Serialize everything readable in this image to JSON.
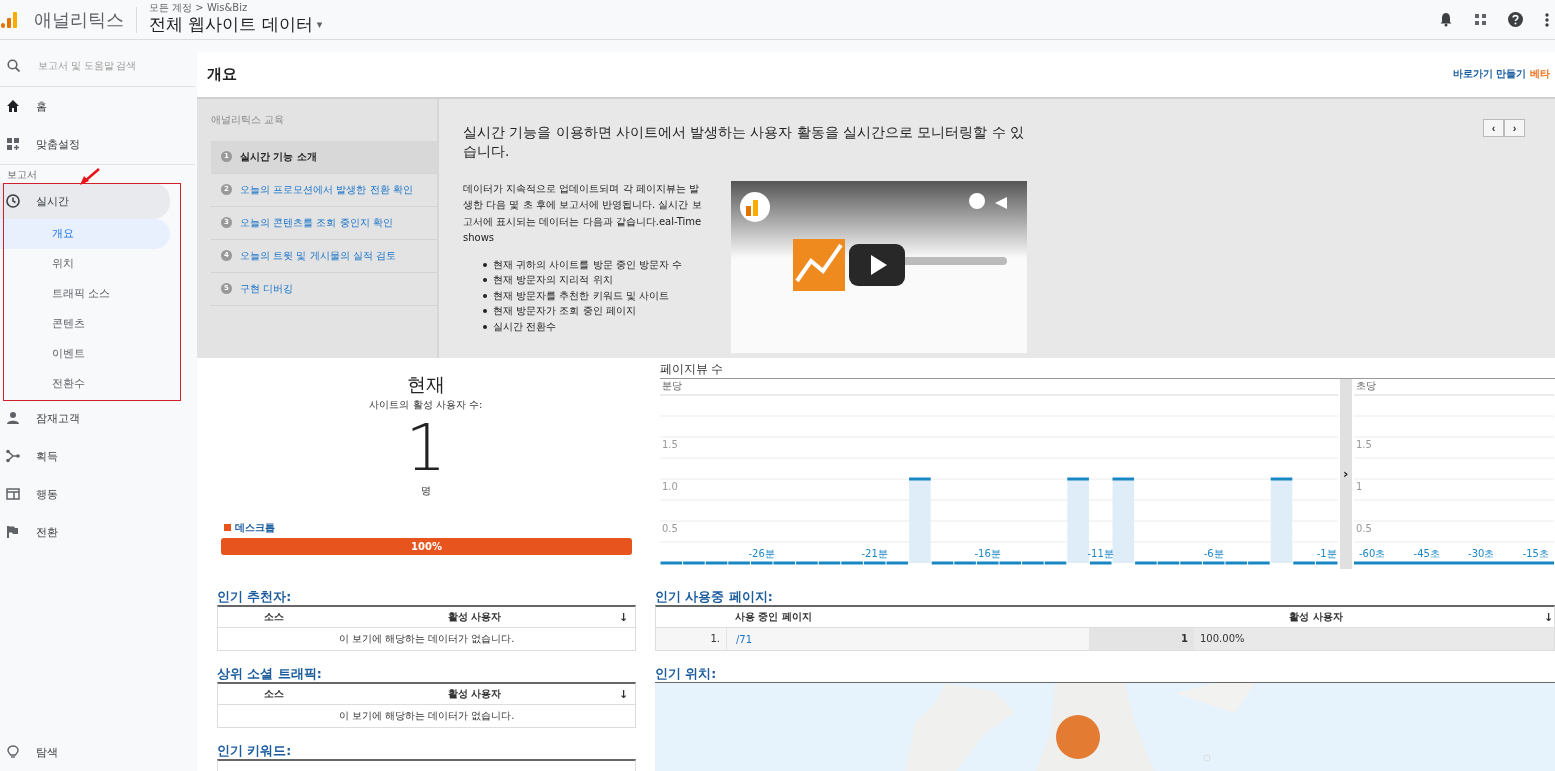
{
  "header": {
    "logo_text": "애널리틱스",
    "breadcrumb": "모든 계정 > Wis&Biz",
    "property": "전체 웹사이트 데이터",
    "caret": "▾"
  },
  "search": {
    "placeholder": "보고서 및 도움말 검색"
  },
  "sidebar": {
    "items": [
      {
        "label": "홈"
      },
      {
        "label": "맞춤설정"
      }
    ],
    "section_label": "보고서",
    "reports": [
      {
        "label": "실시간",
        "expanded": true,
        "children": [
          {
            "label": "개요",
            "selected": true
          },
          {
            "label": "위치",
            "selected": false
          },
          {
            "label": "트래픽 소스",
            "selected": false
          },
          {
            "label": "콘텐츠",
            "selected": false
          },
          {
            "label": "이벤트",
            "selected": false
          },
          {
            "label": "전환수",
            "selected": false
          }
        ]
      },
      {
        "label": "잠재고객",
        "expanded": false
      },
      {
        "label": "획득",
        "expanded": false
      },
      {
        "label": "행동",
        "expanded": false
      },
      {
        "label": "전환",
        "expanded": false
      }
    ],
    "bottom_item": {
      "label": "탐색"
    }
  },
  "page": {
    "title": "개요",
    "shortcut": {
      "label": "바로가기 만들기",
      "badge": "베타"
    }
  },
  "education": {
    "heading": "애널리틱스 교육",
    "steps": [
      {
        "number": "1",
        "label": "실시간 기능 소개",
        "selected": true
      },
      {
        "number": "2",
        "label": "오늘의 프로모션에서 발생한 전환 확인",
        "selected": false
      },
      {
        "number": "3",
        "label": "오늘의 콘텐츠를 조회 중인지 확인",
        "selected": false
      },
      {
        "number": "4",
        "label": "오늘의 트윗 및 게시물의 실적 검토",
        "selected": false
      },
      {
        "number": "5",
        "label": "구현 디버깅",
        "selected": false
      }
    ],
    "lead": "실시간 기능을 이용하면 사이트에서 발생하는 사용자 활동을 실시간으로 모니터링할 수 있습니다.",
    "body": "데이터가 지속적으로 업데이트되며 각 페이지뷰는 발생한 다음 몇 초 후에 보고서에 반영됩니다. 실시간 보고서에 표시되는 데이터는 다음과 같습니다.eal-Time shows",
    "bullets": [
      "현재 귀하의 사이트를 방문 중인 방문자 수",
      "현재 방문자의 지리적 위치",
      "현재 방문자를 추천한 키워드 및 사이트",
      "현재 방문자가 조회 중인 페이지",
      "실시간 전환수"
    ],
    "video": {
      "kind": "picture"
    },
    "prev": "‹",
    "next": "›"
  },
  "current": {
    "heading": "현재",
    "subheading": "사이트의 활성 사용자 수:",
    "count": "1",
    "unit": "명",
    "device": {
      "label": "데스크톱",
      "color": "#e8541e",
      "level": 1,
      "reading": "100%"
    }
  },
  "pageviews": {
    "title": "페이지뷰 수",
    "toggle": "›",
    "minute": {
      "label": "분당",
      "chart_data": {
        "type": "bar",
        "grid": true,
        "xlim": [
          -30.5,
          -0.5
        ],
        "x": [
          -30,
          -29,
          -28,
          -27,
          -26,
          -25,
          -24,
          -23,
          -22,
          -21,
          -20,
          -19,
          -18,
          -17,
          -16,
          -15,
          -14,
          -13,
          -12,
          -11,
          -10,
          -9,
          -8,
          -7,
          -6,
          -5,
          -4,
          -3,
          -2,
          -1
        ],
        "values": [
          0,
          0,
          0,
          0,
          0,
          0,
          0,
          0,
          0,
          0,
          0,
          1,
          0,
          0,
          0,
          0,
          0,
          0,
          1,
          0,
          1,
          0,
          0,
          0,
          0,
          0,
          0,
          1,
          0,
          0
        ],
        "ylim": [
          0,
          2
        ],
        "yticks": [
          0.5,
          {
            "value": 1,
            "label": "1.0"
          },
          1.5
        ],
        "xticks": [
          {
            "value": -26,
            "label": "-26분"
          },
          {
            "value": -21,
            "label": "-21분"
          },
          {
            "value": -16,
            "label": "-16분"
          },
          {
            "value": -11,
            "label": "-11분"
          },
          {
            "value": -6,
            "label": "-6분"
          },
          {
            "value": -1,
            "label": "-1분"
          }
        ]
      }
    },
    "second": {
      "label": "초당",
      "chart_data": {
        "type": "bar",
        "grid": true,
        "xlim": [
          -65,
          -10
        ],
        "ylim": [
          0,
          2
        ],
        "yticks": [
          0.5,
          1,
          1.5
        ],
        "xticks": [
          {
            "value": -60,
            "label": "-60초"
          },
          {
            "value": -45,
            "label": "-45초"
          },
          {
            "value": -30,
            "label": "-30초"
          },
          {
            "value": -15,
            "label": "-15초"
          }
        ]
      }
    }
  },
  "referrers": {
    "title": "인기 추천자:",
    "columns": [
      "소스",
      "활성 사용자"
    ],
    "sort": "↓",
    "empty_message": "이 보기에 해당하는 데이터가 없습니다."
  },
  "social": {
    "title": "상위 소셜 트래픽:",
    "columns": [
      "소스",
      "활성 사용자"
    ],
    "sort": "↓",
    "empty_message": "이 보기에 해당하는 데이터가 없습니다."
  },
  "keywords": {
    "title": "인기 키워드:"
  },
  "top_pages": {
    "title": "인기 사용중 페이지:",
    "columns": [
      "사용 중인 페이지",
      "활성 사용자"
    ],
    "sort": "↓",
    "rows": [
      {
        "rank": "1.",
        "page": "/71",
        "users": "1",
        "share": "100.00%"
      }
    ]
  },
  "locations": {
    "title": "인기 위치:",
    "map": {
      "kind": "picture"
    }
  }
}
